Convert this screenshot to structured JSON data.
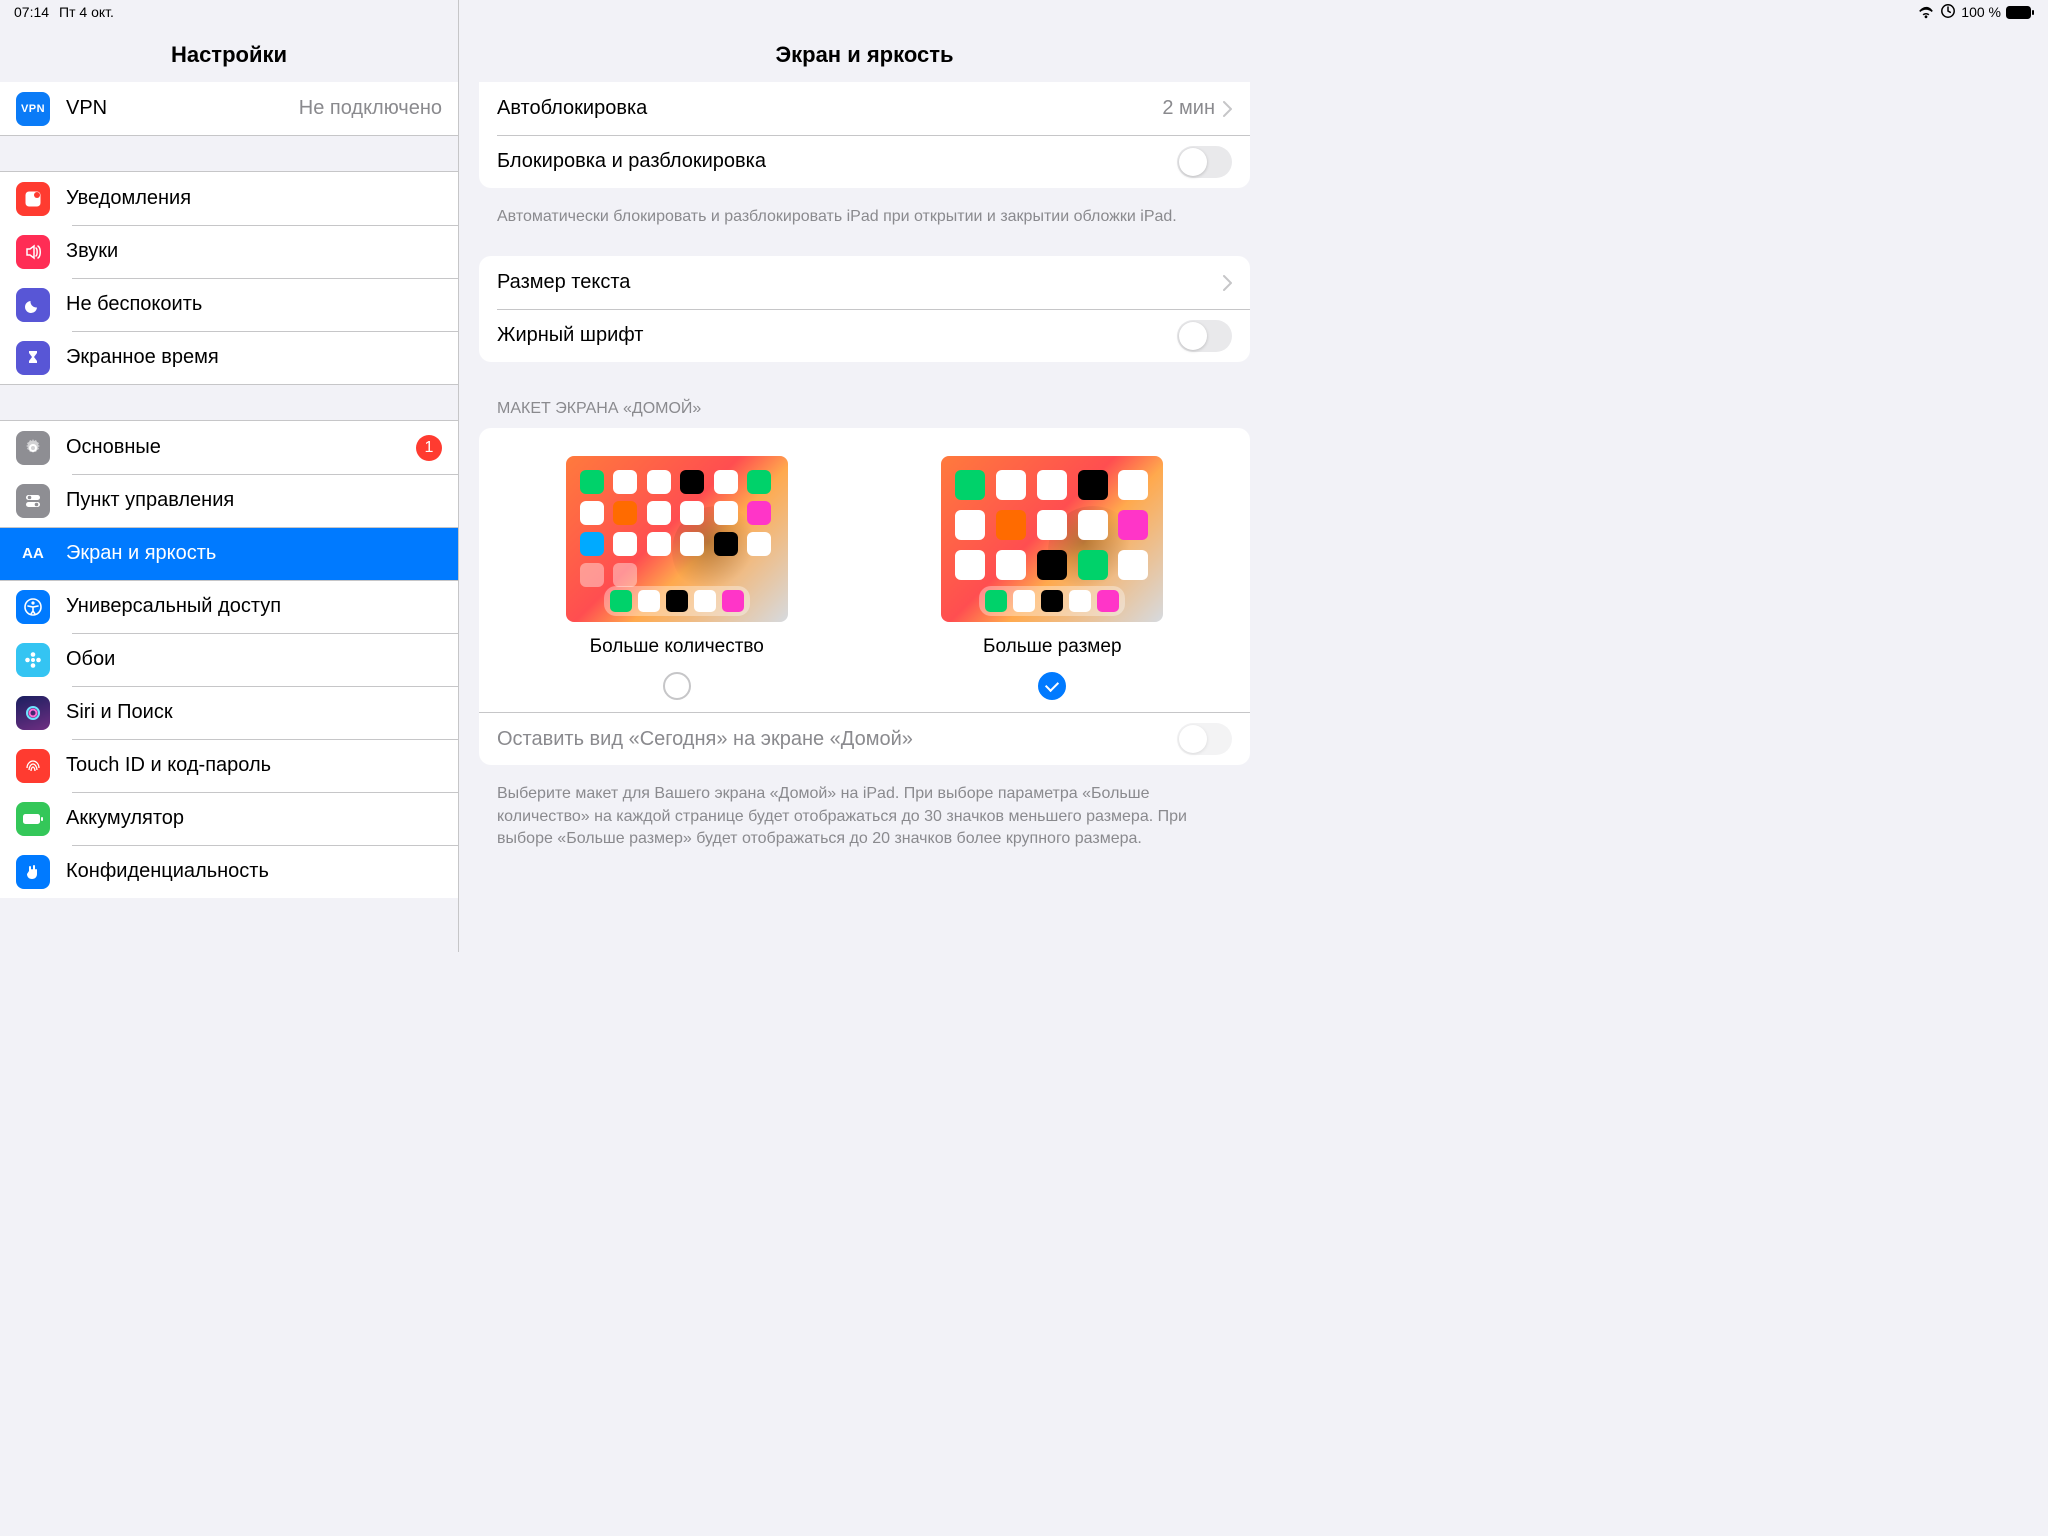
{
  "status": {
    "time": "07:14",
    "date": "Пт 4 окт.",
    "battery_pct": "100 %"
  },
  "sidebar": {
    "title": "Настройки",
    "vpn": {
      "label": "VPN",
      "value": "Не подключено"
    },
    "group2": {
      "notifications": "Уведомления",
      "sounds": "Звуки",
      "dnd": "Не беспокоить",
      "screentime": "Экранное время"
    },
    "group3": {
      "general": "Основные",
      "general_badge": "1",
      "control": "Пункт управления",
      "display": "Экран и яркость",
      "access": "Универсальный доступ",
      "wallpaper": "Обои",
      "siri": "Siri и Поиск",
      "touchid": "Touch ID и код-пароль",
      "battery": "Аккумулятор",
      "privacy": "Конфиденциальность"
    }
  },
  "pane": {
    "title": "Экран и яркость",
    "autolock": {
      "label": "Автоблокировка",
      "value": "2 мин"
    },
    "lockunlock": {
      "label": "Блокировка и разблокировка"
    },
    "lockunlock_foot": "Автоматически блокировать и разблокировать iPad при открытии и закрытии обложки iPad.",
    "textsize": "Размер текста",
    "bold": "Жирный шрифт",
    "home_header": "МАКЕТ ЭКРАНА «ДОМОЙ»",
    "opt_more": "Больше количество",
    "opt_big": "Больше размер",
    "today": "Оставить вид «Сегодня» на экране «Домой»",
    "home_foot": "Выберите макет для Вашего экрана «Домой» на iPad. При выборе параметра «Больше количество» на каждой странице будет отображаться до 30 значков меньшего размера. При выборе «Больше размер» будет отображаться до 20 значков более крупного размера."
  }
}
